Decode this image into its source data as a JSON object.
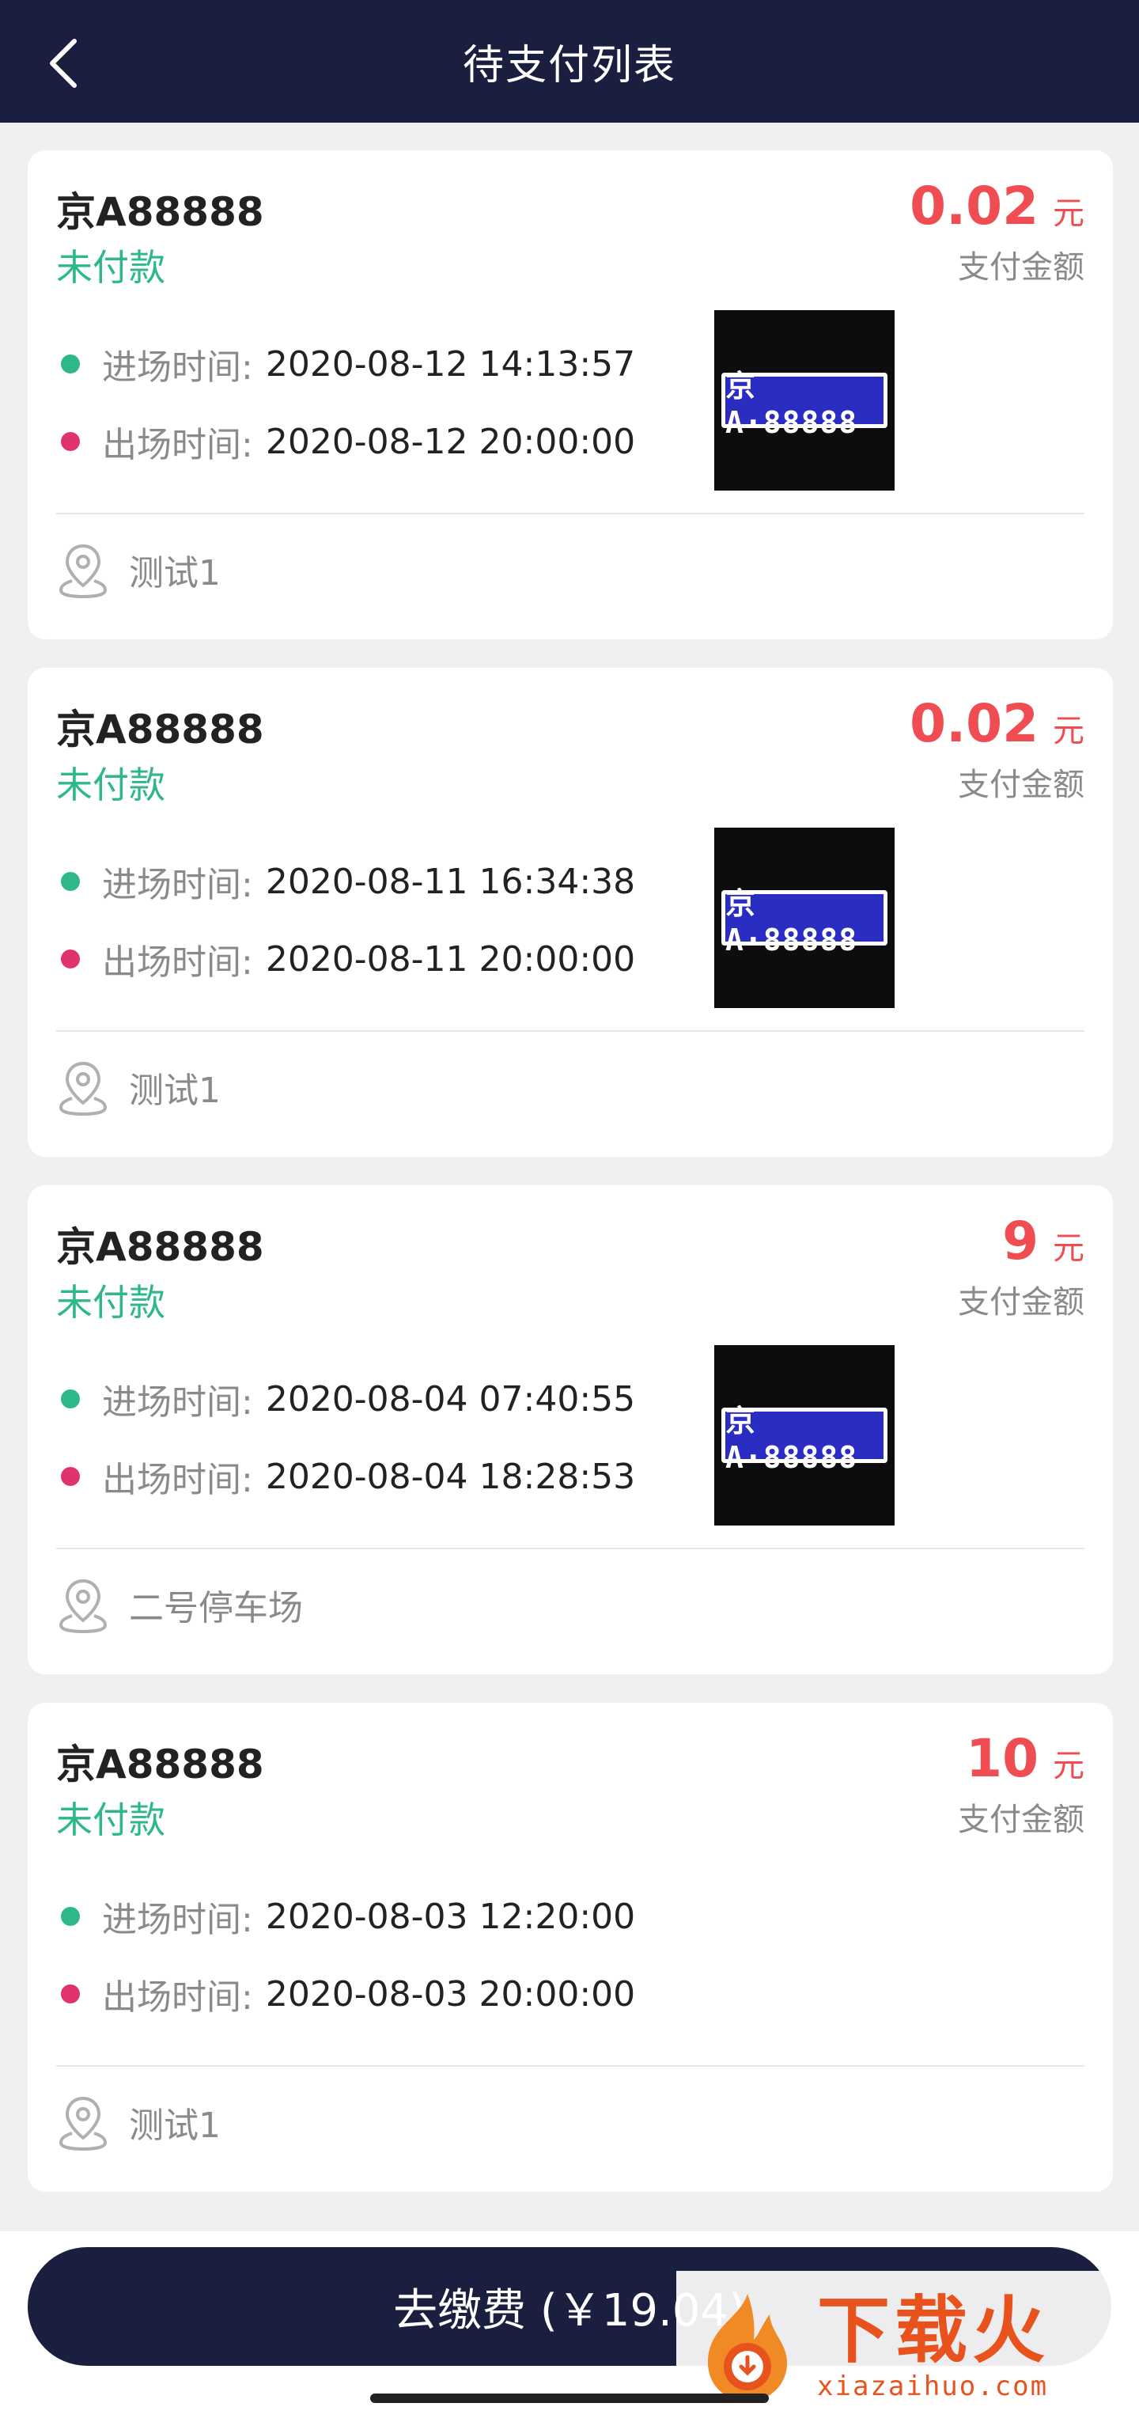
{
  "header": {
    "title": "待支付列表"
  },
  "orders": [
    {
      "plate": "京A88888",
      "status": "未付款",
      "amount": "0.02",
      "unit": "元",
      "amount_label": "支付金额",
      "in_label": "进场时间:",
      "in_time": "2020-08-12 14:13:57",
      "out_label": "出场时间:",
      "out_time": "2020-08-12 20:00:00",
      "photo_plate": "京A·88888",
      "location": "测试1"
    },
    {
      "plate": "京A88888",
      "status": "未付款",
      "amount": "0.02",
      "unit": "元",
      "amount_label": "支付金额",
      "in_label": "进场时间:",
      "in_time": "2020-08-11 16:34:38",
      "out_label": "出场时间:",
      "out_time": "2020-08-11 20:00:00",
      "photo_plate": "京A·88888",
      "location": "测试1"
    },
    {
      "plate": "京A88888",
      "status": "未付款",
      "amount": "9",
      "unit": "元",
      "amount_label": "支付金额",
      "in_label": "进场时间:",
      "in_time": "2020-08-04 07:40:55",
      "out_label": "出场时间:",
      "out_time": "2020-08-04 18:28:53",
      "photo_plate": "京A·88888",
      "location": "二号停车场"
    },
    {
      "plate": "京A88888",
      "status": "未付款",
      "amount": "10",
      "unit": "元",
      "amount_label": "支付金额",
      "in_label": "进场时间:",
      "in_time": "2020-08-03 12:20:00",
      "out_label": "出场时间:",
      "out_time": "2020-08-03 20:00:00",
      "photo_plate": "",
      "location": "测试1"
    }
  ],
  "pay_button": {
    "label": "去缴费 (￥19.04)"
  },
  "watermark": {
    "title": "下载火",
    "subtitle": "xiazaihuo.com"
  },
  "colors": {
    "navy": "#1b1f3f",
    "green": "#2eb88a",
    "red": "#ef4d52",
    "pink": "#e0336b"
  },
  "icons": {
    "back": "chevron-left-icon",
    "location": "map-pin-icon",
    "in_dot": "green-dot",
    "out_dot": "red-dot"
  }
}
